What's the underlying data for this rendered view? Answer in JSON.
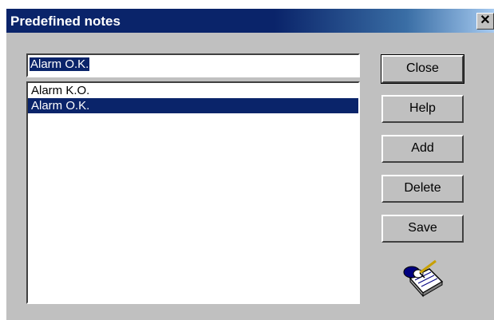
{
  "window": {
    "title": "Predefined notes",
    "close_glyph": "✕",
    "close_icon": "close-icon"
  },
  "note_input": {
    "value": "Alarm O.K."
  },
  "notes_list": {
    "items": [
      {
        "label": "Alarm K.O.",
        "selected": false
      },
      {
        "label": "Alarm O.K.",
        "selected": true
      }
    ]
  },
  "buttons": {
    "close": "Close",
    "help": "Help",
    "add": "Add",
    "delete": "Delete",
    "save": "Save"
  },
  "icons": {
    "notepad": "notepad-pen-icon"
  },
  "colors": {
    "title_bar": "#0a246a",
    "selection": "#0a246a",
    "dialog_face": "#c0c0c0"
  }
}
